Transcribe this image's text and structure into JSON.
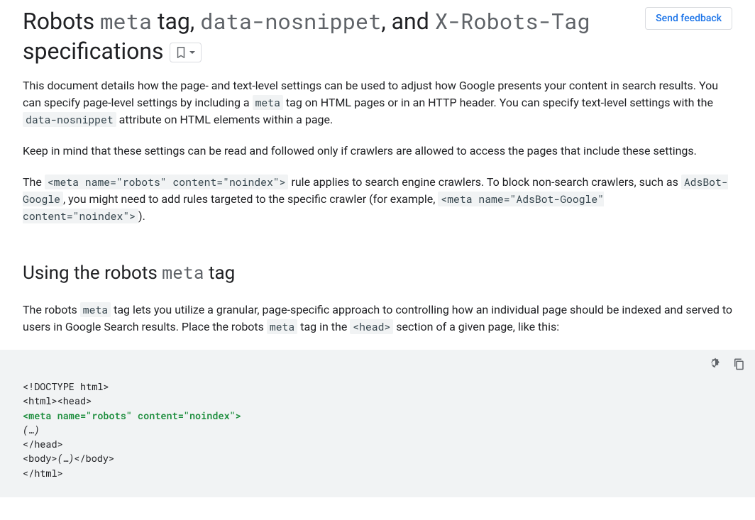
{
  "header": {
    "title_parts": [
      "Robots ",
      "meta",
      " tag, ",
      "data-nosnippet",
      ", and ",
      "X-Robots-Tag",
      " specifications"
    ],
    "feedback_label": "Send feedback"
  },
  "intro": {
    "p1_a": "This document details how the page- and text-level settings can be used to adjust how Google presents your content in search results. You can specify page-level settings by including a ",
    "p1_code1": "meta",
    "p1_b": " tag on HTML pages or in an HTTP header. You can specify text-level settings with the ",
    "p1_code2": "data-nosnippet",
    "p1_c": " attribute on HTML elements within a page.",
    "p2": "Keep in mind that these settings can be read and followed only if crawlers are allowed to access the pages that include these settings.",
    "p3_a": "The ",
    "p3_code1": "<meta name=\"robots\" content=\"noindex\">",
    "p3_b": " rule applies to search engine crawlers. To block non-search crawlers, such as ",
    "p3_code2": "AdsBot-Google",
    "p3_c": ", you might need to add rules targeted to the specific crawler (for example, ",
    "p3_code3": "<meta name=\"AdsBot-Google\" content=\"noindex\">",
    "p3_d": ")."
  },
  "section2": {
    "heading_a": "Using the robots ",
    "heading_code": "meta",
    "heading_b": " tag",
    "p1_a": "The robots ",
    "p1_code1": "meta",
    "p1_b": " tag lets you utilize a granular, page-specific approach to controlling how an individual page should be indexed and served to users in Google Search results. Place the robots ",
    "p1_code2": "meta",
    "p1_c": " tag in the ",
    "p1_code3": "<head>",
    "p1_d": " section of a given page, like this:"
  },
  "codeblock": {
    "l1": "<!DOCTYPE html>",
    "l2": "<html><head>",
    "l3": "<meta name=\"robots\" content=\"noindex\">",
    "l4": "(…)",
    "l5": "</head>",
    "l6": "<body>",
    "l6b": "(…)",
    "l6c": "</body>",
    "l7": "</html>"
  }
}
